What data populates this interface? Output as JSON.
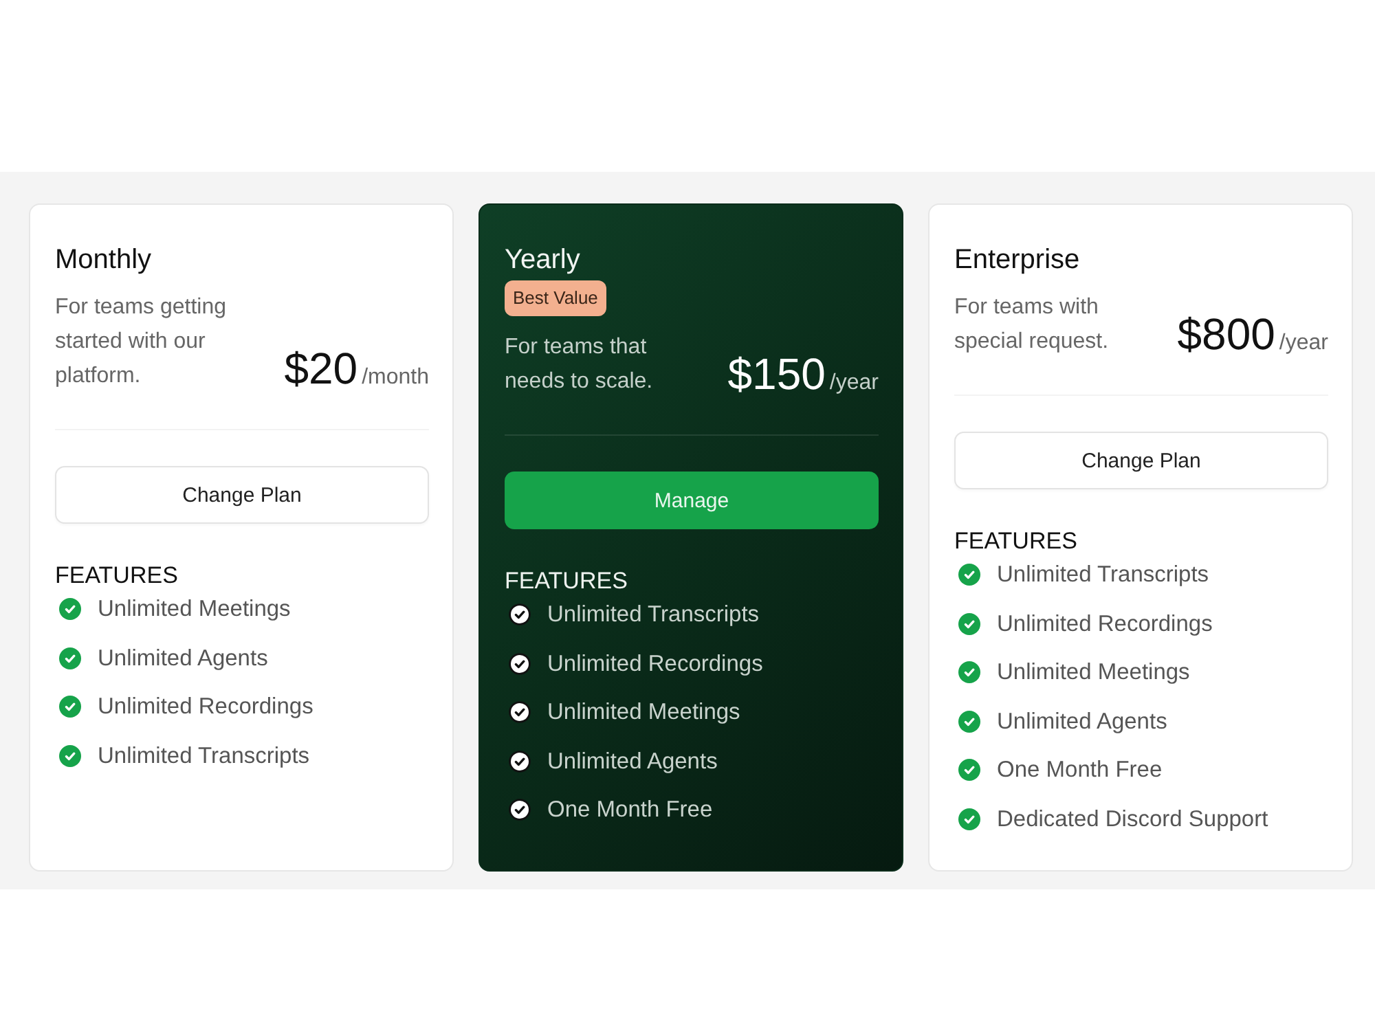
{
  "plans": [
    {
      "name": "Monthly",
      "highlighted": false,
      "description": "For teams getting started with our platform.",
      "price": "$20",
      "period": "/month",
      "button": "Change Plan",
      "features_heading": "FEATURES",
      "features": [
        "Unlimited Meetings",
        "Unlimited Agents",
        "Unlimited Recordings",
        "Unlimited Transcripts"
      ]
    },
    {
      "name": "Yearly",
      "highlighted": true,
      "badge": "Best Value",
      "description": "For teams that needs to scale.",
      "price": "$150",
      "period": "/year",
      "button": "Manage",
      "features_heading": "FEATURES",
      "features": [
        "Unlimited Transcripts",
        "Unlimited Recordings",
        "Unlimited Meetings",
        "Unlimited Agents",
        "One Month Free"
      ]
    },
    {
      "name": "Enterprise",
      "highlighted": false,
      "description": "For teams with special request.",
      "price": "$800",
      "period": "/year",
      "button": "Change Plan",
      "features_heading": "FEATURES",
      "features": [
        "Unlimited Transcripts",
        "Unlimited Recordings",
        "Unlimited Meetings",
        "Unlimited Agents",
        "One Month Free",
        "Dedicated Discord Support"
      ]
    }
  ]
}
